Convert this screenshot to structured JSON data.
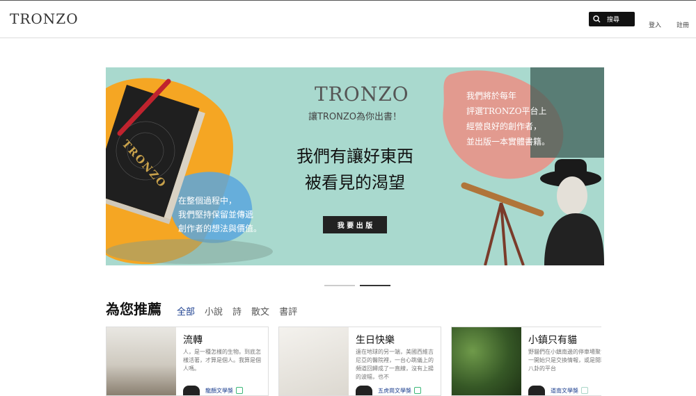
{
  "header": {
    "logo": "TRONZO",
    "search_label": "搜尋",
    "login_label": "登入",
    "register_label": "註冊"
  },
  "banner": {
    "logo": "TRONZO",
    "subtitle": "讓TRONZO為你出書！",
    "headline_1": "我們有讓好東西",
    "headline_2": "被看見的渴望",
    "cta_label": "我 要 出 版",
    "book_title": "TRONZO",
    "left_text_1": "在整個過程中，",
    "left_text_2": "我們堅持保留並傳遞",
    "left_text_3": "創作者的想法與價值。",
    "right_text_1": "我們將於每年",
    "right_text_2": "評選TRONZO平台上",
    "right_text_3": "經營良好的創作者，",
    "right_text_4": "並出版一本實體書籍。"
  },
  "section": {
    "title": "為您推薦",
    "tabs": [
      "全部",
      "小說",
      "詩",
      "散文",
      "書評"
    ]
  },
  "cards": [
    {
      "title": "流轉",
      "excerpt": "人，是一種怎樣的生物。到底怎樣活著，才算是個人。我算是個人嗎。",
      "author": "龍顏文學獎"
    },
    {
      "title": "生日快樂",
      "excerpt": "遠在地球的另一端，美國西維吉尼亞的醫院裡，一台心跳儀上的頻道回歸成了一直線，沒有上揚的波幅，也不",
      "author": "五虎崗文學獎"
    },
    {
      "title": "小鎮只有貓",
      "excerpt": "野貓們在小鎮南邊的停車場聚會一開始只是交換情報，或是閒聊八卦的平台",
      "author": "道南文學獎"
    }
  ],
  "colors": {
    "banner_bg": "#a9d9ce",
    "orange": "#f5a623",
    "pink": "#e29a8f",
    "accent_blue": "#1c3f8f"
  }
}
